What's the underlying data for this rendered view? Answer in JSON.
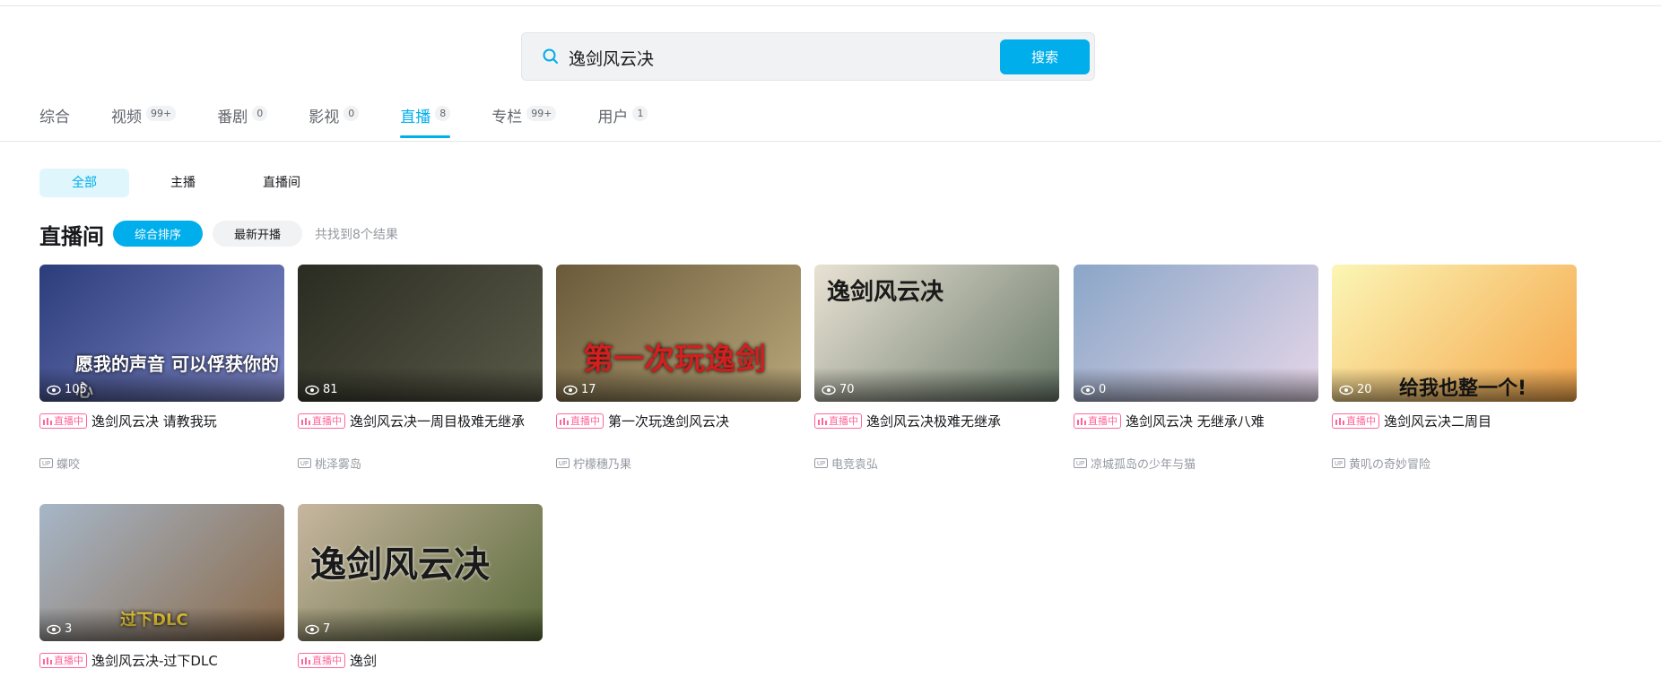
{
  "search": {
    "value": "逸剑风云决",
    "button_label": "搜索"
  },
  "tabs": [
    {
      "label": "综合",
      "count": ""
    },
    {
      "label": "视频",
      "count": "99+"
    },
    {
      "label": "番剧",
      "count": "0"
    },
    {
      "label": "影视",
      "count": "0"
    },
    {
      "label": "直播",
      "count": "8"
    },
    {
      "label": "专栏",
      "count": "99+"
    },
    {
      "label": "用户",
      "count": "1"
    }
  ],
  "filters": [
    "全部",
    "主播",
    "直播间"
  ],
  "section": {
    "title": "直播间",
    "sort_primary": "综合排序",
    "sort_secondary": "最新开播",
    "result_count": "共找到8个结果"
  },
  "live_badge": "直播中",
  "cards": [
    {
      "viewers": "105",
      "title": "逸剑风云决 请教我玩",
      "up": "蝶咬",
      "overlay": "愿我的声音 可以俘获你的心",
      "colors": [
        "#2c3c7a",
        "#7f88c8"
      ]
    },
    {
      "viewers": "81",
      "title": "逸剑风云决一周目极难无继承",
      "up": "桃泽雾岛",
      "overlay": "",
      "colors": [
        "#2a2c22",
        "#5a5a48"
      ]
    },
    {
      "viewers": "17",
      "title": "第一次玩逸剑风云决",
      "up": "柠檬穗乃果",
      "overlay": "第一次玩逸剑",
      "colors": [
        "#6b5a3a",
        "#b8a77a"
      ]
    },
    {
      "viewers": "70",
      "title": "逸剑风云决极难无继承",
      "up": "电竞袁弘",
      "overlay": "逸剑风云决",
      "colors": [
        "#e9e2d4",
        "#6a7a6a"
      ]
    },
    {
      "viewers": "0",
      "title": "逸剑风云决 无继承八难",
      "up": "凉城孤岛の少年与猫",
      "overlay": "",
      "colors": [
        "#8aa6c8",
        "#e6d6e8"
      ]
    },
    {
      "viewers": "20",
      "title": "逸剑风云决二周目",
      "up": "黄叽の奇妙冒险",
      "overlay": "给我也整一个!",
      "colors": [
        "#fbf6b6",
        "#f5a64a"
      ]
    },
    {
      "viewers": "3",
      "title": "逸剑风云决-过下DLC",
      "up": "",
      "overlay": "过下DLC",
      "colors": [
        "#a6b6c8",
        "#8a6a4a"
      ]
    },
    {
      "viewers": "7",
      "title": "逸剑",
      "up": "",
      "overlay": "逸剑风云决",
      "colors": [
        "#c8b6a0",
        "#5a6a3a"
      ]
    }
  ]
}
